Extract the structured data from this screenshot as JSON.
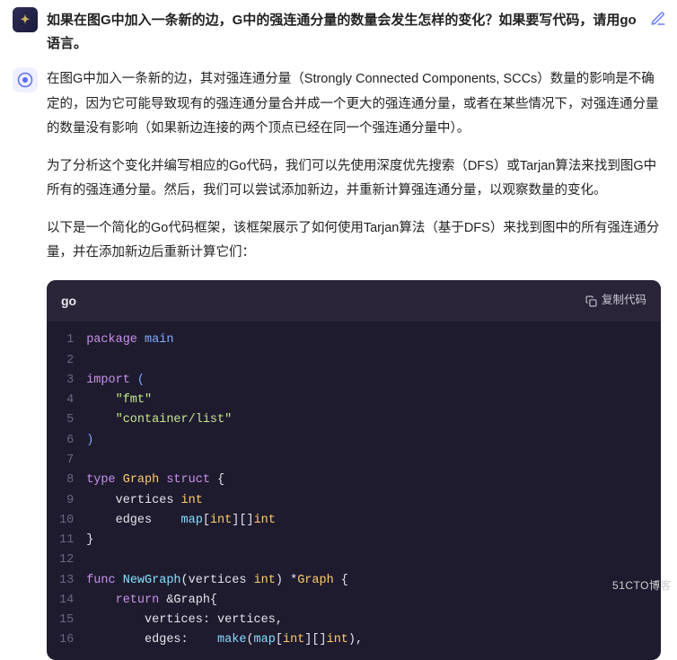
{
  "question": {
    "avatar_glyph": "✦",
    "text": "如果在图G中加入一条新的边，G中的强连通分量的数量会发生怎样的变化？如果要写代码，请用go语言。"
  },
  "answer": {
    "paragraphs": [
      "在图G中加入一条新的边，其对强连通分量（Strongly Connected Components, SCCs）数量的影响是不确定的，因为它可能导致现有的强连通分量合并成一个更大的强连通分量，或者在某些情况下，对强连通分量的数量没有影响（如果新边连接的两个顶点已经在同一个强连通分量中）。",
      "为了分析这个变化并编写相应的Go代码，我们可以先使用深度优先搜索（DFS）或Tarjan算法来找到图G中所有的强连通分量。然后，我们可以尝试添加新边，并重新计算强连通分量，以观察数量的变化。",
      "以下是一个简化的Go代码框架，该框架展示了如何使用Tarjan算法（基于DFS）来找到图中的所有强连通分量，并在添加新边后重新计算它们："
    ]
  },
  "code": {
    "language": "go",
    "copy_label": "复制代码",
    "lines": [
      {
        "n": 1,
        "tokens": [
          {
            "t": "package ",
            "c": "kw"
          },
          {
            "t": "main",
            "c": "pkg"
          }
        ]
      },
      {
        "n": 2,
        "tokens": []
      },
      {
        "n": 3,
        "tokens": [
          {
            "t": "import ",
            "c": "kw"
          },
          {
            "t": "(",
            "c": "pkg"
          }
        ]
      },
      {
        "n": 4,
        "tokens": [
          {
            "t": "    ",
            "c": ""
          },
          {
            "t": "\"fmt\"",
            "c": "str"
          }
        ]
      },
      {
        "n": 5,
        "tokens": [
          {
            "t": "    ",
            "c": ""
          },
          {
            "t": "\"container/list\"",
            "c": "str"
          }
        ]
      },
      {
        "n": 6,
        "tokens": [
          {
            "t": ")",
            "c": "pkg"
          }
        ]
      },
      {
        "n": 7,
        "tokens": []
      },
      {
        "n": 8,
        "tokens": [
          {
            "t": "type ",
            "c": "kw"
          },
          {
            "t": "Graph ",
            "c": "typ"
          },
          {
            "t": "struct ",
            "c": "kw"
          },
          {
            "t": "{",
            "c": ""
          }
        ]
      },
      {
        "n": 9,
        "tokens": [
          {
            "t": "    vertices ",
            "c": "ident"
          },
          {
            "t": "int",
            "c": "typ"
          }
        ]
      },
      {
        "n": 10,
        "tokens": [
          {
            "t": "    edges    ",
            "c": "ident"
          },
          {
            "t": "map",
            "c": "builtin"
          },
          {
            "t": "[",
            "c": ""
          },
          {
            "t": "int",
            "c": "typ"
          },
          {
            "t": "][]",
            "c": ""
          },
          {
            "t": "int",
            "c": "typ"
          }
        ]
      },
      {
        "n": 11,
        "tokens": [
          {
            "t": "}",
            "c": ""
          }
        ]
      },
      {
        "n": 12,
        "tokens": []
      },
      {
        "n": 13,
        "tokens": [
          {
            "t": "func ",
            "c": "kw"
          },
          {
            "t": "NewGraph",
            "c": "fn"
          },
          {
            "t": "(",
            "c": ""
          },
          {
            "t": "vertices ",
            "c": "ident"
          },
          {
            "t": "int",
            "c": "typ"
          },
          {
            "t": ") *",
            "c": ""
          },
          {
            "t": "Graph ",
            "c": "typ"
          },
          {
            "t": "{",
            "c": ""
          }
        ]
      },
      {
        "n": 14,
        "tokens": [
          {
            "t": "    ",
            "c": ""
          },
          {
            "t": "return ",
            "c": "kw"
          },
          {
            "t": "&Graph{",
            "c": ""
          }
        ]
      },
      {
        "n": 15,
        "tokens": [
          {
            "t": "        vertices: vertices,",
            "c": "ident"
          }
        ]
      },
      {
        "n": 16,
        "tokens": [
          {
            "t": "        edges:    ",
            "c": "ident"
          },
          {
            "t": "make",
            "c": "builtin"
          },
          {
            "t": "(",
            "c": ""
          },
          {
            "t": "map",
            "c": "builtin"
          },
          {
            "t": "[",
            "c": ""
          },
          {
            "t": "int",
            "c": "typ"
          },
          {
            "t": "][]",
            "c": ""
          },
          {
            "t": "int",
            "c": "typ"
          },
          {
            "t": "),",
            "c": ""
          }
        ]
      }
    ]
  },
  "watermark": "51CTO博客"
}
